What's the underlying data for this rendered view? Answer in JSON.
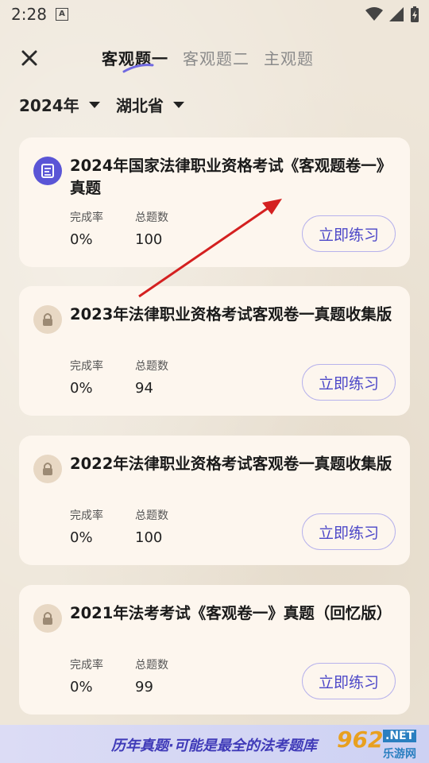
{
  "status": {
    "time": "2:28"
  },
  "tabs": [
    {
      "label": "客观题一"
    },
    {
      "label": "客观题二"
    },
    {
      "label": "主观题"
    }
  ],
  "filters": {
    "year": "2024年",
    "province": "湖北省"
  },
  "cards": [
    {
      "title": "2024年国家法律职业资格考试《客观题卷一》真题",
      "completion_label": "完成率",
      "completion": "0%",
      "total_label": "总题数",
      "total": "100",
      "button": "立即练习",
      "icon": "document-icon"
    },
    {
      "title": "2023年法律职业资格考试客观卷一真题收集版",
      "completion_label": "完成率",
      "completion": "0%",
      "total_label": "总题数",
      "total": "94",
      "button": "立即练习",
      "icon": "lock-icon"
    },
    {
      "title": "2022年法律职业资格考试客观卷一真题收集版",
      "completion_label": "完成率",
      "completion": "0%",
      "total_label": "总题数",
      "total": "100",
      "button": "立即练习",
      "icon": "lock-icon"
    },
    {
      "title": "2021年法考考试《客观卷一》真题（回忆版）",
      "completion_label": "完成率",
      "completion": "0%",
      "total_label": "总题数",
      "total": "99",
      "button": "立即练习",
      "icon": "lock-icon"
    }
  ],
  "banner": {
    "text": "历年真题·可能是最全的法考题库"
  },
  "watermark": {
    "number": "962",
    "net": ".NET",
    "site": "乐游网"
  },
  "colors": {
    "accent": "#4c47c8",
    "arrow": "#d42020"
  }
}
